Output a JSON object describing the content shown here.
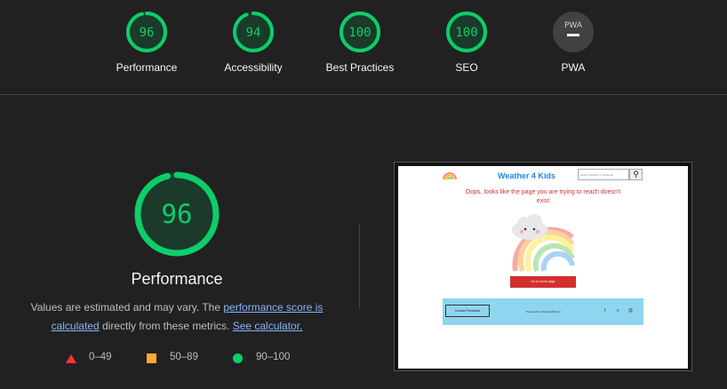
{
  "colors": {
    "pass": "#0cce6b",
    "average": "#ffaa33",
    "fail": "#ff3333",
    "background": "#212121"
  },
  "gauges": [
    {
      "label": "Performance",
      "score": "96",
      "fraction": 0.96
    },
    {
      "label": "Accessibility",
      "score": "94",
      "fraction": 0.94
    },
    {
      "label": "Best Practices",
      "score": "100",
      "fraction": 1.0
    },
    {
      "label": "SEO",
      "score": "100",
      "fraction": 1.0
    },
    {
      "label": "PWA",
      "score": "PWA",
      "icon": "pwa-dash-icon"
    }
  ],
  "performance": {
    "score": "96",
    "fraction": 0.96,
    "title": "Performance",
    "desc_prefix": "Values are estimated and may vary. The ",
    "desc_link": "performance score is calculated",
    "desc_middle": " directly from these metrics. ",
    "desc_link2": "See calculator."
  },
  "legend": [
    {
      "icon": "triangle-fail-icon",
      "range": "0–49"
    },
    {
      "icon": "square-average-icon",
      "range": "50–89"
    },
    {
      "icon": "circle-pass-icon",
      "range": "90–100"
    }
  ],
  "screenshot": {
    "brand": "Weather 4 Kids",
    "search_placeholder": "Search location or postcode",
    "search_icon": "magnifier-icon",
    "error_message": "Oops, looks like the page you are trying to reach doesn't exist",
    "home_button": "Go to home page",
    "feedback_button": "Contact Feedback",
    "footer_text": "Powered by WeatherAPI.com",
    "social_icons": [
      "f",
      "x",
      "@"
    ]
  }
}
